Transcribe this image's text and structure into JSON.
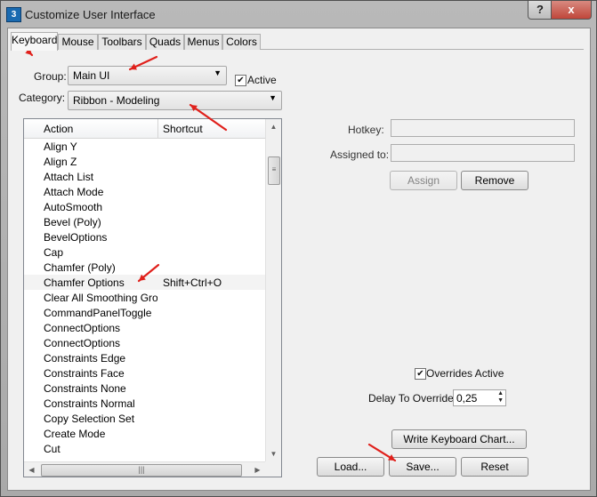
{
  "window": {
    "title": "Customize User Interface",
    "icon_glyph": "3",
    "help_label": "?",
    "close_label": "x"
  },
  "tabs": [
    {
      "label": "Keyboard",
      "active": true
    },
    {
      "label": "Mouse"
    },
    {
      "label": "Toolbars"
    },
    {
      "label": "Quads"
    },
    {
      "label": "Menus"
    },
    {
      "label": "Colors"
    }
  ],
  "group": {
    "label": "Group:",
    "value": "Main UI"
  },
  "active_checkbox": {
    "label": "Active",
    "checked": true,
    "mark": "✔"
  },
  "category": {
    "label": "Category:",
    "value": "Ribbon - Modeling"
  },
  "action_list": {
    "columns": [
      "Action",
      "Shortcut"
    ],
    "rows": [
      {
        "action": "Align Y",
        "shortcut": ""
      },
      {
        "action": "Align Z",
        "shortcut": ""
      },
      {
        "action": "Attach List",
        "shortcut": ""
      },
      {
        "action": "Attach Mode",
        "shortcut": ""
      },
      {
        "action": "AutoSmooth",
        "shortcut": ""
      },
      {
        "action": "Bevel (Poly)",
        "shortcut": ""
      },
      {
        "action": "BevelOptions",
        "shortcut": ""
      },
      {
        "action": "Cap",
        "shortcut": ""
      },
      {
        "action": "Chamfer (Poly)",
        "shortcut": ""
      },
      {
        "action": "Chamfer Options",
        "shortcut": "Shift+Ctrl+O"
      },
      {
        "action": "Clear All Smoothing Gro...",
        "shortcut": ""
      },
      {
        "action": "CommandPanelToggle",
        "shortcut": ""
      },
      {
        "action": "ConnectOptions",
        "shortcut": ""
      },
      {
        "action": "ConnectOptions",
        "shortcut": ""
      },
      {
        "action": "Constraints Edge",
        "shortcut": ""
      },
      {
        "action": "Constraints Face",
        "shortcut": ""
      },
      {
        "action": "Constraints None",
        "shortcut": ""
      },
      {
        "action": "Constraints Normal",
        "shortcut": ""
      },
      {
        "action": "Copy Selection Set",
        "shortcut": ""
      },
      {
        "action": "Create Mode",
        "shortcut": ""
      },
      {
        "action": "Cut",
        "shortcut": ""
      }
    ],
    "selected_index": 9,
    "scroll_up_glyph": "▲",
    "scroll_down_glyph": "▼",
    "scroll_left_glyph": "◀",
    "scroll_right_glyph": "▶",
    "thumb_grip": "≡",
    "hthumb_grip": "|||"
  },
  "hotkey": {
    "label": "Hotkey:",
    "value": ""
  },
  "assigned_to": {
    "label": "Assigned to:",
    "value": ""
  },
  "buttons": {
    "assign": "Assign",
    "remove": "Remove",
    "write_chart": "Write Keyboard Chart...",
    "load": "Load...",
    "save": "Save...",
    "reset": "Reset"
  },
  "overrides_active": {
    "label": "Overrides Active",
    "checked": true,
    "mark": "✔"
  },
  "delay_to_override": {
    "label": "Delay To Override:",
    "value": "0,25",
    "up": "▲",
    "down": "▼"
  },
  "combo_arrow": "▼",
  "annotation_color": "#e0201b"
}
